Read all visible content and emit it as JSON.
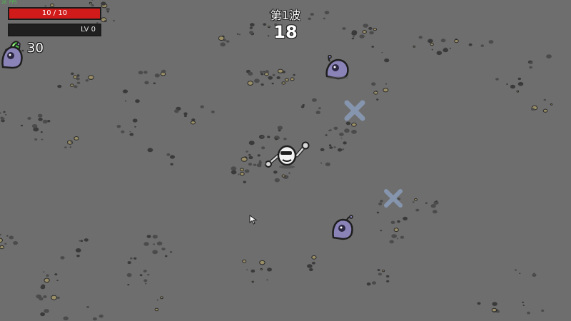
{
  "hud": {
    "fps": "26 FPS",
    "hp_text": "10 / 10",
    "hp_current": 10,
    "hp_max": 10,
    "level_text": "LV 0",
    "xp_progress": 0.0,
    "materials_count": "30",
    "material_icon": "green-material-icon"
  },
  "wave": {
    "title": "第1波",
    "timer": "18"
  },
  "colors": {
    "ground": "#6e6e6e",
    "hp_fill": "#d11b1b",
    "xp_fill": "#3a8a2a",
    "enemy": "#8a83b8",
    "spawn_marker": "#8fa2c4",
    "material": "#4fc24a"
  },
  "entities": {
    "player": "potato-player-with-wrenches",
    "enemies": [
      "baby-alien",
      "baby-alien",
      "baby-alien"
    ],
    "spawn_markers": [
      "enemy-spawn-x-marker",
      "enemy-spawn-x-marker"
    ],
    "cursor": "arrow-cursor-icon"
  }
}
